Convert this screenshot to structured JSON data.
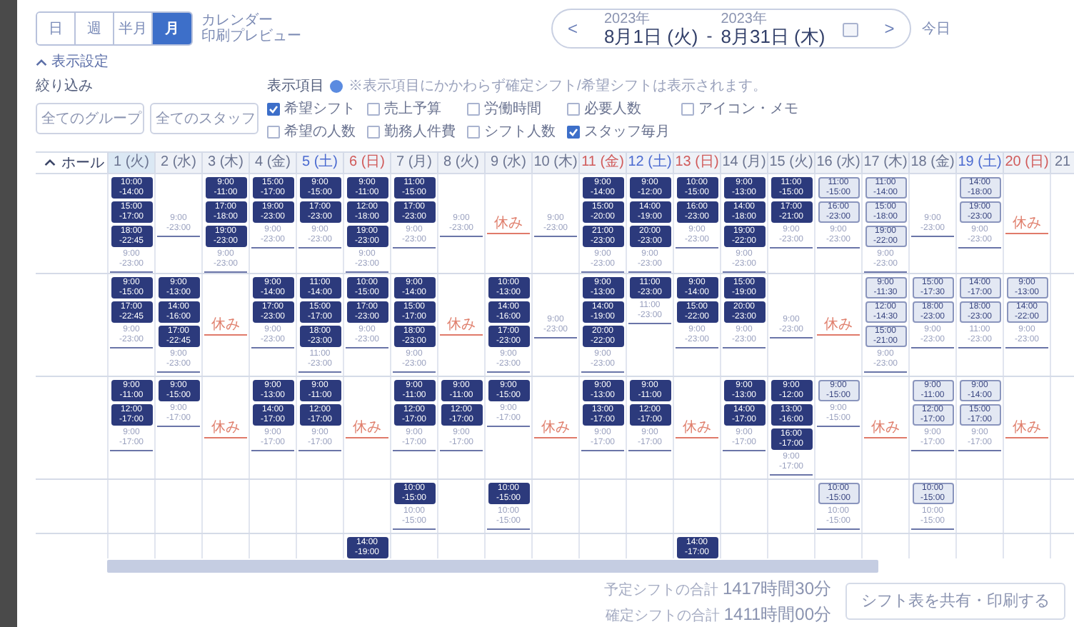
{
  "views": [
    {
      "label": "日",
      "selected": false
    },
    {
      "label": "週",
      "selected": false
    },
    {
      "label": "半月",
      "selected": false
    },
    {
      "label": "月",
      "selected": true
    }
  ],
  "print_link": {
    "line1": "カレンダー",
    "line2": "印刷プレビュー"
  },
  "date_range": {
    "prev": "<",
    "start_year": "2023年",
    "start": "8月1日 (火)",
    "separator": "-",
    "end_year": "2023年",
    "end": "8月31日 (木)",
    "next": ">",
    "today": "今日"
  },
  "display_toggle": {
    "label": "表示設定",
    "expanded": true
  },
  "filter": {
    "label": "絞り込み",
    "selects": [
      "全てのグループ",
      "全てのスタッフ"
    ]
  },
  "display_items": {
    "label": "表示項目",
    "note": "※表示項目にかかわらず確定シフト/希望シフトは表示されます。",
    "options": [
      {
        "label": "希望シフト",
        "checked": true
      },
      {
        "label": "売上予算",
        "checked": false
      },
      {
        "label": "労働時間",
        "checked": false
      },
      {
        "label": "必要人数",
        "checked": false
      },
      {
        "label": "アイコン・メモ",
        "checked": false
      },
      {
        "label": "希望の人数",
        "checked": false
      },
      {
        "label": "勤務人件費",
        "checked": false
      },
      {
        "label": "シフト人数",
        "checked": false
      },
      {
        "label": "スタッフ毎月",
        "checked": true
      }
    ]
  },
  "table": {
    "group": {
      "label": "ホール",
      "expanded": true
    },
    "days": [
      {
        "label": "1 (火)",
        "kind": "weekday",
        "selected": true
      },
      {
        "label": "2 (水)",
        "kind": "weekday",
        "selected": false
      },
      {
        "label": "3 (木)",
        "kind": "weekday",
        "selected": false
      },
      {
        "label": "4 (金)",
        "kind": "weekday",
        "selected": false
      },
      {
        "label": "5 (土)",
        "kind": "saturday",
        "selected": false
      },
      {
        "label": "6 (日)",
        "kind": "holiday",
        "selected": false
      },
      {
        "label": "7 (月)",
        "kind": "weekday",
        "selected": false
      },
      {
        "label": "8 (火)",
        "kind": "weekday",
        "selected": false
      },
      {
        "label": "9 (水)",
        "kind": "weekday",
        "selected": false
      },
      {
        "label": "10 (木)",
        "kind": "weekday",
        "selected": false
      },
      {
        "label": "11 (金)",
        "kind": "holiday",
        "selected": false
      },
      {
        "label": "12 (土)",
        "kind": "saturday",
        "selected": false
      },
      {
        "label": "13 (日)",
        "kind": "holiday",
        "selected": false
      },
      {
        "label": "14 (月)",
        "kind": "weekday",
        "selected": false
      },
      {
        "label": "15 (火)",
        "kind": "weekday",
        "selected": false
      },
      {
        "label": "16 (水)",
        "kind": "weekday",
        "selected": false
      },
      {
        "label": "17 (木)",
        "kind": "weekday",
        "selected": false
      },
      {
        "label": "18 (金)",
        "kind": "weekday",
        "selected": false
      },
      {
        "label": "19 (土)",
        "kind": "saturday",
        "selected": false
      },
      {
        "label": "20 (日)",
        "kind": "holiday",
        "selected": false
      },
      {
        "label": "21",
        "kind": "weekday",
        "selected": false
      }
    ],
    "rows": [
      {
        "cells": [
          [
            {
              "kind": "confirmed",
              "from": "10:00",
              "to": "-14:00"
            },
            {
              "kind": "confirmed",
              "from": "15:00",
              "to": "-17:00"
            },
            {
              "kind": "confirmed",
              "from": "18:00",
              "to": "-22:45"
            },
            {
              "kind": "available",
              "from": "9:00",
              "to": "-23:00"
            }
          ],
          [
            {
              "kind": "available",
              "from": "9:00",
              "to": "-23:00"
            }
          ],
          [
            {
              "kind": "confirmed",
              "from": "9:00",
              "to": "-11:00"
            },
            {
              "kind": "confirmed",
              "from": "17:00",
              "to": "-18:00"
            },
            {
              "kind": "confirmed",
              "from": "19:00",
              "to": "-23:00"
            },
            {
              "kind": "available",
              "from": "9:00",
              "to": "-23:00"
            }
          ],
          [
            {
              "kind": "confirmed",
              "from": "15:00",
              "to": "-17:00"
            },
            {
              "kind": "confirmed",
              "from": "19:00",
              "to": "-23:00"
            },
            {
              "kind": "available",
              "from": "9:00",
              "to": "-23:00"
            }
          ],
          [
            {
              "kind": "confirmed",
              "from": "9:00",
              "to": "-15:00"
            },
            {
              "kind": "confirmed",
              "from": "17:00",
              "to": "-23:00"
            },
            {
              "kind": "available",
              "from": "9:00",
              "to": "-23:00"
            }
          ],
          [
            {
              "kind": "confirmed",
              "from": "9:00",
              "to": "-11:00"
            },
            {
              "kind": "confirmed",
              "from": "12:00",
              "to": "-18:00"
            },
            {
              "kind": "confirmed",
              "from": "19:00",
              "to": "-23:00"
            },
            {
              "kind": "available",
              "from": "9:00",
              "to": "-23:00"
            }
          ],
          [
            {
              "kind": "confirmed",
              "from": "11:00",
              "to": "-15:00"
            },
            {
              "kind": "confirmed",
              "from": "17:00",
              "to": "-23:00"
            },
            {
              "kind": "available",
              "from": "9:00",
              "to": "-23:00"
            }
          ],
          [
            {
              "kind": "available",
              "from": "9:00",
              "to": "-23:00"
            }
          ],
          [
            {
              "kind": "off",
              "text": "休み"
            }
          ],
          [
            {
              "kind": "available",
              "from": "9:00",
              "to": "-23:00"
            }
          ],
          [
            {
              "kind": "confirmed",
              "from": "9:00",
              "to": "-14:00"
            },
            {
              "kind": "confirmed",
              "from": "15:00",
              "to": "-20:00"
            },
            {
              "kind": "confirmed",
              "from": "21:00",
              "to": "-23:00"
            },
            {
              "kind": "available",
              "from": "9:00",
              "to": "-23:00"
            }
          ],
          [
            {
              "kind": "confirmed",
              "from": "9:00",
              "to": "-12:00"
            },
            {
              "kind": "confirmed",
              "from": "14:00",
              "to": "-19:00"
            },
            {
              "kind": "confirmed",
              "from": "20:00",
              "to": "-23:00"
            },
            {
              "kind": "available",
              "from": "9:00",
              "to": "-23:00"
            }
          ],
          [
            {
              "kind": "confirmed",
              "from": "10:00",
              "to": "-15:00"
            },
            {
              "kind": "confirmed",
              "from": "16:00",
              "to": "-23:00"
            },
            {
              "kind": "available",
              "from": "9:00",
              "to": "-23:00"
            }
          ],
          [
            {
              "kind": "confirmed",
              "from": "9:00",
              "to": "-13:00"
            },
            {
              "kind": "confirmed",
              "from": "14:00",
              "to": "-18:00"
            },
            {
              "kind": "confirmed",
              "from": "19:00",
              "to": "-22:00"
            },
            {
              "kind": "available",
              "from": "9:00",
              "to": "-23:00"
            }
          ],
          [
            {
              "kind": "confirmed",
              "from": "11:00",
              "to": "-15:00"
            },
            {
              "kind": "confirmed",
              "from": "17:00",
              "to": "-21:00"
            },
            {
              "kind": "available",
              "from": "9:00",
              "to": "-23:00"
            }
          ],
          [
            {
              "kind": "request",
              "from": "11:00",
              "to": "-15:00"
            },
            {
              "kind": "request",
              "from": "16:00",
              "to": "-23:00"
            },
            {
              "kind": "available",
              "from": "9:00",
              "to": "-23:00"
            }
          ],
          [
            {
              "kind": "request",
              "from": "11:00",
              "to": "-14:00"
            },
            {
              "kind": "request",
              "from": "15:00",
              "to": "-18:00"
            },
            {
              "kind": "request",
              "from": "19:00",
              "to": "-22:00"
            },
            {
              "kind": "available",
              "from": "9:00",
              "to": "-23:00"
            }
          ],
          [
            {
              "kind": "available",
              "from": "9:00",
              "to": "-23:00"
            }
          ],
          [
            {
              "kind": "request",
              "from": "14:00",
              "to": "-18:00"
            },
            {
              "kind": "request",
              "from": "19:00",
              "to": "-23:00"
            },
            {
              "kind": "available",
              "from": "9:00",
              "to": "-23:00"
            }
          ],
          [
            {
              "kind": "off",
              "text": "休み"
            }
          ]
        ]
      },
      {
        "cells": [
          [
            {
              "kind": "confirmed",
              "from": "9:00",
              "to": "-15:00"
            },
            {
              "kind": "confirmed",
              "from": "17:00",
              "to": "-22:45"
            },
            {
              "kind": "available",
              "from": "9:00",
              "to": "-23:00"
            }
          ],
          [
            {
              "kind": "confirmed",
              "from": "9:00",
              "to": "-13:00"
            },
            {
              "kind": "confirmed",
              "from": "14:00",
              "to": "-16:00"
            },
            {
              "kind": "confirmed",
              "from": "17:00",
              "to": "-22:45"
            },
            {
              "kind": "available",
              "from": "9:00",
              "to": "-23:00"
            }
          ],
          [
            {
              "kind": "off",
              "text": "休み"
            }
          ],
          [
            {
              "kind": "confirmed",
              "from": "9:00",
              "to": "-14:00"
            },
            {
              "kind": "confirmed",
              "from": "17:00",
              "to": "-23:00"
            },
            {
              "kind": "available",
              "from": "9:00",
              "to": "-23:00"
            }
          ],
          [
            {
              "kind": "confirmed",
              "from": "11:00",
              "to": "-14:00"
            },
            {
              "kind": "confirmed",
              "from": "15:00",
              "to": "-17:00"
            },
            {
              "kind": "confirmed",
              "from": "18:00",
              "to": "-23:00"
            },
            {
              "kind": "available",
              "from": "11:00",
              "to": "-23:00"
            }
          ],
          [
            {
              "kind": "confirmed",
              "from": "10:00",
              "to": "-15:00"
            },
            {
              "kind": "confirmed",
              "from": "17:00",
              "to": "-23:00"
            },
            {
              "kind": "available",
              "from": "9:00",
              "to": "-23:00"
            }
          ],
          [
            {
              "kind": "confirmed",
              "from": "9:00",
              "to": "-14:00"
            },
            {
              "kind": "confirmed",
              "from": "15:00",
              "to": "-17:00"
            },
            {
              "kind": "confirmed",
              "from": "18:00",
              "to": "-23:00"
            },
            {
              "kind": "available",
              "from": "9:00",
              "to": "-23:00"
            }
          ],
          [
            {
              "kind": "off",
              "text": "休み"
            }
          ],
          [
            {
              "kind": "confirmed",
              "from": "10:00",
              "to": "-13:00"
            },
            {
              "kind": "confirmed",
              "from": "14:00",
              "to": "-16:00"
            },
            {
              "kind": "confirmed",
              "from": "17:00",
              "to": "-23:00"
            },
            {
              "kind": "available",
              "from": "9:00",
              "to": "-23:00"
            }
          ],
          [
            {
              "kind": "available",
              "from": "9:00",
              "to": "-23:00"
            }
          ],
          [
            {
              "kind": "confirmed",
              "from": "9:00",
              "to": "-13:00"
            },
            {
              "kind": "confirmed",
              "from": "14:00",
              "to": "-19:00"
            },
            {
              "kind": "confirmed",
              "from": "20:00",
              "to": "-22:00"
            },
            {
              "kind": "available",
              "from": "9:00",
              "to": "-23:00"
            }
          ],
          [
            {
              "kind": "confirmed",
              "from": "11:00",
              "to": "-23:00"
            },
            {
              "kind": "available",
              "from": "11:00",
              "to": "-23:00"
            }
          ],
          [
            {
              "kind": "confirmed",
              "from": "9:00",
              "to": "-14:00"
            },
            {
              "kind": "confirmed",
              "from": "15:00",
              "to": "-22:00"
            },
            {
              "kind": "available",
              "from": "9:00",
              "to": "-23:00"
            }
          ],
          [
            {
              "kind": "confirmed",
              "from": "15:00",
              "to": "-19:00"
            },
            {
              "kind": "confirmed",
              "from": "20:00",
              "to": "-23:00"
            },
            {
              "kind": "available",
              "from": "9:00",
              "to": "-23:00"
            }
          ],
          [
            {
              "kind": "available",
              "from": "9:00",
              "to": "-23:00"
            }
          ],
          [
            {
              "kind": "off",
              "text": "休み"
            }
          ],
          [
            {
              "kind": "request",
              "from": "9:00",
              "to": "-11:30"
            },
            {
              "kind": "request",
              "from": "12:00",
              "to": "-14:30"
            },
            {
              "kind": "request",
              "from": "15:00",
              "to": "-21:00"
            },
            {
              "kind": "available",
              "from": "9:00",
              "to": "-23:00"
            }
          ],
          [
            {
              "kind": "request",
              "from": "15:00",
              "to": "-17:30"
            },
            {
              "kind": "request",
              "from": "18:00",
              "to": "-23:00"
            },
            {
              "kind": "available",
              "from": "9:00",
              "to": "-23:00"
            }
          ],
          [
            {
              "kind": "request",
              "from": "14:00",
              "to": "-17:00"
            },
            {
              "kind": "request",
              "from": "18:00",
              "to": "-23:00"
            },
            {
              "kind": "available",
              "from": "11:00",
              "to": "-23:00"
            }
          ],
          [
            {
              "kind": "request",
              "from": "9:00",
              "to": "-13:00"
            },
            {
              "kind": "request",
              "from": "14:00",
              "to": "-22:00"
            },
            {
              "kind": "available",
              "from": "9:00",
              "to": "-23:00"
            }
          ]
        ]
      },
      {
        "cells": [
          [
            {
              "kind": "confirmed",
              "from": "9:00",
              "to": "-11:00"
            },
            {
              "kind": "confirmed",
              "from": "12:00",
              "to": "-17:00"
            },
            {
              "kind": "available",
              "from": "9:00",
              "to": "-17:00"
            }
          ],
          [
            {
              "kind": "confirmed",
              "from": "9:00",
              "to": "-15:00"
            },
            {
              "kind": "available",
              "from": "9:00",
              "to": "-17:00"
            }
          ],
          [
            {
              "kind": "off",
              "text": "休み"
            }
          ],
          [
            {
              "kind": "confirmed",
              "from": "9:00",
              "to": "-13:00"
            },
            {
              "kind": "confirmed",
              "from": "14:00",
              "to": "-17:00"
            },
            {
              "kind": "available",
              "from": "9:00",
              "to": "-17:00"
            }
          ],
          [
            {
              "kind": "confirmed",
              "from": "9:00",
              "to": "-11:00"
            },
            {
              "kind": "confirmed",
              "from": "12:00",
              "to": "-17:00"
            },
            {
              "kind": "available",
              "from": "9:00",
              "to": "-17:00"
            }
          ],
          [
            {
              "kind": "off",
              "text": "休み"
            }
          ],
          [
            {
              "kind": "confirmed",
              "from": "9:00",
              "to": "-11:00"
            },
            {
              "kind": "confirmed",
              "from": "12:00",
              "to": "-17:00"
            },
            {
              "kind": "available",
              "from": "9:00",
              "to": "-17:00"
            }
          ],
          [
            {
              "kind": "confirmed",
              "from": "9:00",
              "to": "-11:00"
            },
            {
              "kind": "confirmed",
              "from": "12:00",
              "to": "-17:00"
            },
            {
              "kind": "available",
              "from": "9:00",
              "to": "-17:00"
            }
          ],
          [
            {
              "kind": "confirmed",
              "from": "9:00",
              "to": "-15:00"
            },
            {
              "kind": "available",
              "from": "9:00",
              "to": "-17:00"
            }
          ],
          [
            {
              "kind": "off",
              "text": "休み"
            }
          ],
          [
            {
              "kind": "confirmed",
              "from": "9:00",
              "to": "-13:00"
            },
            {
              "kind": "confirmed",
              "from": "13:00",
              "to": "-17:00"
            },
            {
              "kind": "available",
              "from": "9:00",
              "to": "-17:00"
            }
          ],
          [
            {
              "kind": "confirmed",
              "from": "9:00",
              "to": "-11:00"
            },
            {
              "kind": "confirmed",
              "from": "12:00",
              "to": "-17:00"
            },
            {
              "kind": "available",
              "from": "9:00",
              "to": "-17:00"
            }
          ],
          [
            {
              "kind": "off",
              "text": "休み"
            }
          ],
          [
            {
              "kind": "confirmed",
              "from": "9:00",
              "to": "-13:00"
            },
            {
              "kind": "confirmed",
              "from": "14:00",
              "to": "-17:00"
            },
            {
              "kind": "available",
              "from": "9:00",
              "to": "-17:00"
            }
          ],
          [
            {
              "kind": "confirmed",
              "from": "9:00",
              "to": "-12:00"
            },
            {
              "kind": "confirmed",
              "from": "13:00",
              "to": "-16:00"
            },
            {
              "kind": "confirmed",
              "from": "16:00",
              "to": "-17:00"
            },
            {
              "kind": "available",
              "from": "9:00",
              "to": "-17:00"
            }
          ],
          [
            {
              "kind": "request",
              "from": "9:00",
              "to": "-15:00"
            },
            {
              "kind": "available",
              "from": "9:00",
              "to": "-15:00"
            }
          ],
          [
            {
              "kind": "off",
              "text": "休み"
            }
          ],
          [
            {
              "kind": "request",
              "from": "9:00",
              "to": "-11:00"
            },
            {
              "kind": "request",
              "from": "12:00",
              "to": "-17:00"
            },
            {
              "kind": "available",
              "from": "9:00",
              "to": "-17:00"
            }
          ],
          [
            {
              "kind": "request",
              "from": "9:00",
              "to": "-14:00"
            },
            {
              "kind": "request",
              "from": "15:00",
              "to": "-17:00"
            },
            {
              "kind": "available",
              "from": "9:00",
              "to": "-17:00"
            }
          ],
          [
            {
              "kind": "off",
              "text": "休み"
            }
          ]
        ]
      },
      {
        "cells": [
          [],
          [],
          [],
          [],
          [],
          [],
          [
            {
              "kind": "confirmed",
              "from": "10:00",
              "to": "-15:00"
            },
            {
              "kind": "available",
              "from": "10:00",
              "to": "-15:00"
            }
          ],
          [],
          [
            {
              "kind": "confirmed",
              "from": "10:00",
              "to": "-15:00"
            },
            {
              "kind": "available",
              "from": "10:00",
              "to": "-15:00"
            }
          ],
          [],
          [],
          [],
          [],
          [],
          [],
          [
            {
              "kind": "request",
              "from": "10:00",
              "to": "-15:00"
            },
            {
              "kind": "available",
              "from": "10:00",
              "to": "-15:00"
            }
          ],
          [],
          [
            {
              "kind": "request",
              "from": "10:00",
              "to": "-15:00"
            },
            {
              "kind": "available",
              "from": "10:00",
              "to": "-15:00"
            }
          ],
          [],
          []
        ]
      },
      {
        "cells": [
          [],
          [],
          [],
          [],
          [],
          [
            {
              "kind": "confirmed",
              "from": "14:00",
              "to": "-19:00"
            }
          ],
          [],
          [],
          [],
          [],
          [],
          [],
          [
            {
              "kind": "confirmed",
              "from": "14:00",
              "to": "-17:00"
            }
          ],
          [],
          [],
          [],
          [],
          [],
          [],
          []
        ]
      }
    ]
  },
  "totals": [
    {
      "label": "予定シフトの合計",
      "value": "1417時間30分"
    },
    {
      "label": "確定シフトの合計",
      "value": "1411時間00分"
    }
  ],
  "share_button": "シフト表を共有・印刷する"
}
